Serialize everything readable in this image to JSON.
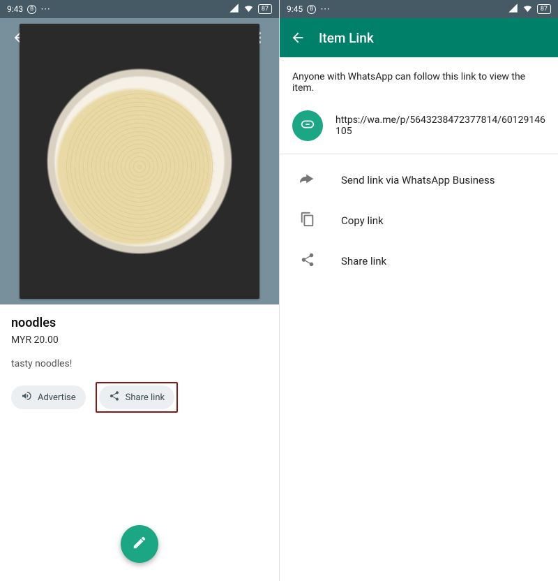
{
  "left": {
    "status": {
      "time": "9:43",
      "b_badge": "B",
      "battery": "87"
    },
    "item": {
      "title": "noodles",
      "price": "MYR 20.00",
      "description": "tasty noodles!"
    },
    "chips": {
      "advertise": "Advertise",
      "share": "Share link"
    }
  },
  "right": {
    "status": {
      "time": "9:45",
      "b_badge": "B",
      "battery": "87"
    },
    "appbar_title": "Item Link",
    "subtext": "Anyone with WhatsApp can follow this link to view the item.",
    "url": "https://wa.me/p/5643238472377814/60129146105",
    "options": {
      "send": "Send link via WhatsApp Business",
      "copy": "Copy link",
      "share": "Share link"
    }
  }
}
